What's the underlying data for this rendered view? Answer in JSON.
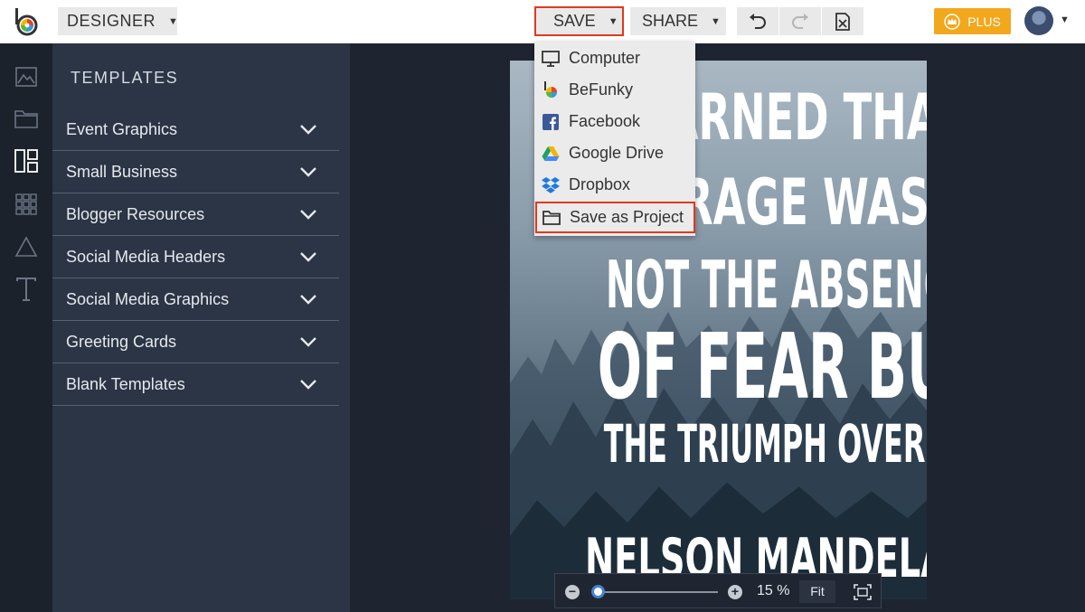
{
  "topbar": {
    "mode_label": "DESIGNER",
    "save_label": "SAVE",
    "share_label": "SHARE",
    "plus_label": "PLUS",
    "icons": [
      "befunky-logo-icon",
      "undo-icon",
      "redo-icon",
      "close-file-icon",
      "crown-icon",
      "user-avatar"
    ]
  },
  "save_menu": {
    "items": [
      {
        "label": "Computer",
        "icon": "monitor-icon"
      },
      {
        "label": "BeFunky",
        "icon": "befunky-icon"
      },
      {
        "label": "Facebook",
        "icon": "facebook-icon"
      },
      {
        "label": "Google Drive",
        "icon": "google-drive-icon"
      },
      {
        "label": "Dropbox",
        "icon": "dropbox-icon"
      },
      {
        "label": "Save as Project",
        "icon": "folder-icon"
      }
    ]
  },
  "rail": {
    "icons": [
      "image-icon",
      "folder-icon",
      "templates-icon",
      "grid-icon",
      "shapes-icon",
      "text-icon"
    ]
  },
  "templates": {
    "title": "TEMPLATES",
    "items": [
      {
        "label": "Event Graphics"
      },
      {
        "label": "Small Business"
      },
      {
        "label": "Blogger Resources"
      },
      {
        "label": "Social Media Headers"
      },
      {
        "label": "Social Media Graphics"
      },
      {
        "label": "Greeting Cards"
      },
      {
        "label": "Blank Templates"
      }
    ]
  },
  "poster": {
    "lines": [
      "I LEARNED THAT",
      "COURAGE WAS",
      "NOT THE ABSENCE",
      "OF FEAR BUT",
      "THE TRIUMPH OVER IT."
    ],
    "author": "NELSON MANDELA"
  },
  "zoom": {
    "percent_label": "15 %",
    "value": 0.15,
    "fit_label": "Fit",
    "minus": "−",
    "plus": "+"
  },
  "colors": {
    "accent_red": "#e0391d",
    "plus_gold": "#f2a81d",
    "panel_bg": "#2c3545",
    "canvas_bg": "#1e2530"
  }
}
